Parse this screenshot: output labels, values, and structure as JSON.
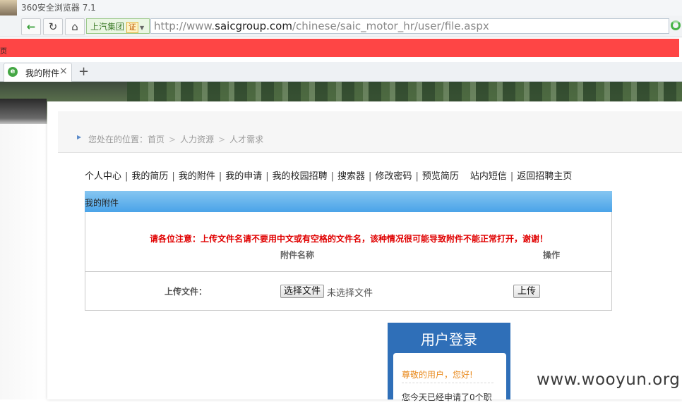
{
  "browser": {
    "title": "360安全浏览器 7.1",
    "site_badge": "上汽集团",
    "cert_label": "证",
    "url_prefix": "http://www.",
    "url_domain": "saicgroup.com",
    "url_path": "/chinese/saic_motor_hr/user/file.aspx",
    "left_fragment": "页",
    "tab_label": "我的附件",
    "tab_close": "×",
    "new_tab": "+",
    "back_icon": "←",
    "refresh_icon": "↻",
    "home_icon": "⌂"
  },
  "breadcrumb": {
    "prefix": "您处在的位置：",
    "items": [
      "首页",
      "人力资源",
      "人才需求"
    ]
  },
  "menu": {
    "items": [
      "个人中心",
      "我的简历",
      "我的附件",
      "我的申请",
      "我的校园招聘",
      "搜索器",
      "修改密码",
      "预览简历",
      "站内短信",
      "返回招聘主页"
    ]
  },
  "panel": {
    "title": "我的附件",
    "notice": "请各位注意：上传文件名请不要用中文或有空格的文件名，该种情况很可能导致附件不能正常打开，谢谢！",
    "col_name": "附件名称",
    "col_action": "操作",
    "upload_label": "上传文件：",
    "choose_button": "选择文件",
    "no_file": "未选择文件",
    "upload_button": "上传"
  },
  "login": {
    "title": "用户登录",
    "greeting": "尊敬的用户，您好!",
    "applied_text": "您今天已经申请了0个职"
  },
  "watermark": "www.wooyun.org",
  "colors": {
    "redaction": "#fe4545",
    "panel_header": "#4aa3e8",
    "notice": "#e00000",
    "login_box": "#2f6fb8"
  }
}
